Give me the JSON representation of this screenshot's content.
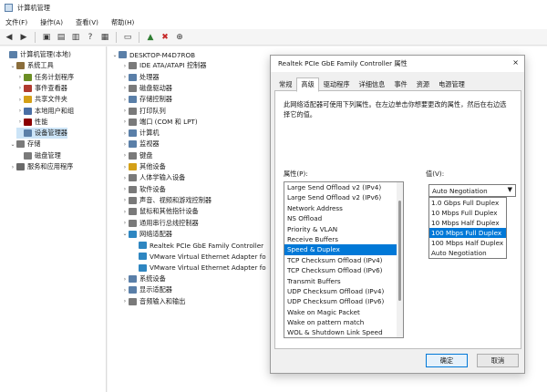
{
  "window": {
    "title": "计算机管理"
  },
  "menu": [
    "文件(F)",
    "操作(A)",
    "查看(V)",
    "帮助(H)"
  ],
  "left_tree": [
    {
      "label": "计算机管理(本地)",
      "indent": 0,
      "twisty": "",
      "color": "#5a7fa8"
    },
    {
      "label": "系统工具",
      "indent": 1,
      "twisty": "⌄",
      "color": "#8a6d3b"
    },
    {
      "label": "任务计划程序",
      "indent": 2,
      "twisty": "›",
      "color": "#6b8e23"
    },
    {
      "label": "事件查看器",
      "indent": 2,
      "twisty": "›",
      "color": "#b03a2e"
    },
    {
      "label": "共享文件夹",
      "indent": 2,
      "twisty": "›",
      "color": "#d4a017"
    },
    {
      "label": "本地用户和组",
      "indent": 2,
      "twisty": "›",
      "color": "#4a6fa5"
    },
    {
      "label": "性能",
      "indent": 2,
      "twisty": "›",
      "color": "#8b0000"
    },
    {
      "label": "设备管理器",
      "indent": 2,
      "twisty": "",
      "color": "#5a7fa8",
      "selected": true
    },
    {
      "label": "存储",
      "indent": 1,
      "twisty": "⌄",
      "color": "#7a7a7a"
    },
    {
      "label": "磁盘管理",
      "indent": 2,
      "twisty": "",
      "color": "#7a7a7a"
    },
    {
      "label": "服务和应用程序",
      "indent": 1,
      "twisty": "›",
      "color": "#6a6a6a"
    }
  ],
  "device_tree": [
    {
      "label": "DESKTOP-M4D7ROB",
      "indent": 0,
      "twisty": "⌄",
      "color": "#5a7fa8"
    },
    {
      "label": "IDE ATA/ATAPI 控制器",
      "indent": 1,
      "twisty": "›",
      "color": "#7a7a7a"
    },
    {
      "label": "处理器",
      "indent": 1,
      "twisty": "›",
      "color": "#5a7fa8"
    },
    {
      "label": "磁盘驱动器",
      "indent": 1,
      "twisty": "›",
      "color": "#7a7a7a"
    },
    {
      "label": "存储控制器",
      "indent": 1,
      "twisty": "›",
      "color": "#5a7fa8"
    },
    {
      "label": "打印队列",
      "indent": 1,
      "twisty": "›",
      "color": "#7a7a7a"
    },
    {
      "label": "端口 (COM 和 LPT)",
      "indent": 1,
      "twisty": "›",
      "color": "#7a7a7a"
    },
    {
      "label": "计算机",
      "indent": 1,
      "twisty": "›",
      "color": "#5a7fa8"
    },
    {
      "label": "监视器",
      "indent": 1,
      "twisty": "›",
      "color": "#5a7fa8"
    },
    {
      "label": "键盘",
      "indent": 1,
      "twisty": "›",
      "color": "#7a7a7a"
    },
    {
      "label": "其他设备",
      "indent": 1,
      "twisty": "›",
      "color": "#d4a017"
    },
    {
      "label": "人体学输入设备",
      "indent": 1,
      "twisty": "›",
      "color": "#7a7a7a"
    },
    {
      "label": "软件设备",
      "indent": 1,
      "twisty": "›",
      "color": "#7a7a7a"
    },
    {
      "label": "声音、视频和游戏控制器",
      "indent": 1,
      "twisty": "›",
      "color": "#7a7a7a"
    },
    {
      "label": "鼠标和其他指针设备",
      "indent": 1,
      "twisty": "›",
      "color": "#7a7a7a"
    },
    {
      "label": "通用串行总线控制器",
      "indent": 1,
      "twisty": "›",
      "color": "#7a7a7a"
    },
    {
      "label": "网络适配器",
      "indent": 1,
      "twisty": "⌄",
      "color": "#2e86c1"
    },
    {
      "label": "Realtek PCIe GbE Family Controller",
      "indent": 2,
      "twisty": "",
      "color": "#2e86c1"
    },
    {
      "label": "VMware Virtual Ethernet Adapter fo",
      "indent": 2,
      "twisty": "",
      "color": "#2e86c1"
    },
    {
      "label": "VMware Virtual Ethernet Adapter fo",
      "indent": 2,
      "twisty": "",
      "color": "#2e86c1"
    },
    {
      "label": "系统设备",
      "indent": 1,
      "twisty": "›",
      "color": "#5a7fa8"
    },
    {
      "label": "显示适配器",
      "indent": 1,
      "twisty": "›",
      "color": "#5a7fa8"
    },
    {
      "label": "音频输入和输出",
      "indent": 1,
      "twisty": "›",
      "color": "#7a7a7a"
    }
  ],
  "dialog": {
    "title": "Realtek PCIe GbE Family Controller 属性",
    "close": "×",
    "tabs": [
      "常规",
      "高级",
      "驱动程序",
      "详细信息",
      "事件",
      "资源",
      "电源管理"
    ],
    "active_tab": 1,
    "description": "此网络适配器可使用下列属性。在左边单击你想要更改的属性，然后在右边选择它的值。",
    "property_label": "属性(P):",
    "value_label": "值(V):",
    "properties": [
      "Large Send Offload v2 (IPv4)",
      "Large Send Offload v2 (IPv6)",
      "Network Address",
      "NS Offload",
      "Priority & VLAN",
      "Receive Buffers",
      "Speed & Duplex",
      "TCP Checksum Offload (IPv4)",
      "TCP Checksum Offload (IPv6)",
      "Transmit Buffers",
      "UDP Checksum Offload (IPv4)",
      "UDP Checksum Offload (IPv6)",
      "Wake on Magic Packet",
      "Wake on pattern match",
      "WOL & Shutdown Link Speed"
    ],
    "selected_property": 6,
    "value_current": "Auto Negotiation",
    "value_options": [
      "1.0 Gbps Full Duplex",
      "10 Mbps Full Duplex",
      "10 Mbps Half Duplex",
      "100 Mbps Full Duplex",
      "100 Mbps Half Duplex",
      "Auto Negotiation"
    ],
    "highlighted_option": 3,
    "ok_label": "确定",
    "cancel_label": "取消"
  }
}
